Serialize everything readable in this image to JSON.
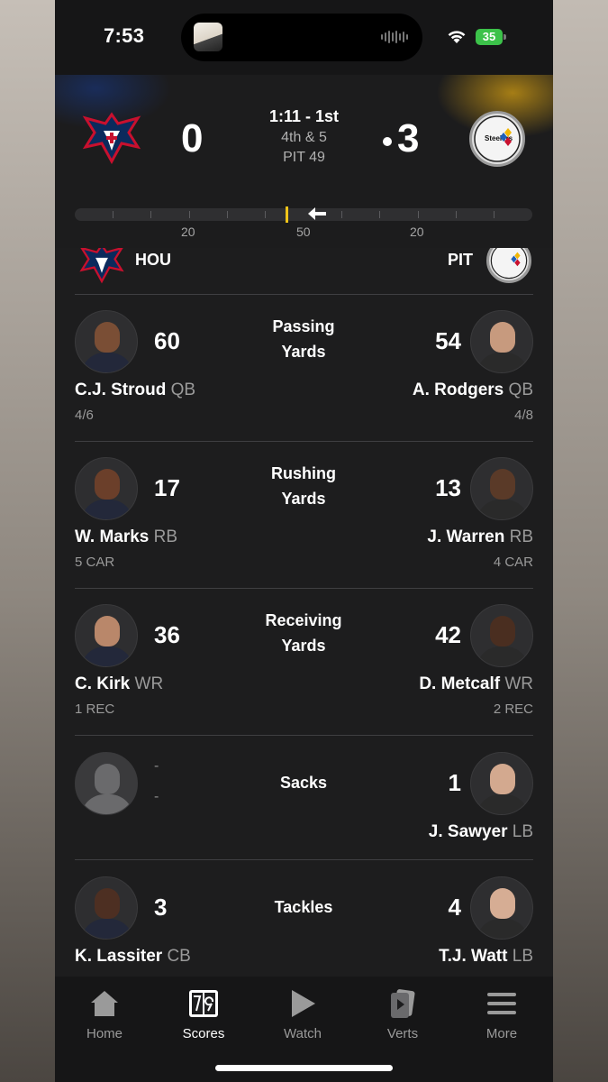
{
  "status_bar": {
    "time": "7:53",
    "battery": "35"
  },
  "game": {
    "clock": "1:11 - 1st",
    "down_distance": "4th & 5",
    "ball_spot": "PIT 49",
    "away": {
      "abbr": "HOU",
      "score": "0",
      "logo_icon": "houston-texans-logo"
    },
    "home": {
      "abbr": "PIT",
      "score": "3",
      "logo_icon": "pittsburgh-steelers-logo",
      "logo_text": "Steelers"
    },
    "field_labels": [
      "20",
      "50",
      "20"
    ],
    "possession": "PIT"
  },
  "stats": [
    {
      "label_line1": "Passing",
      "label_line2": "Yards",
      "left": {
        "value": "60",
        "name": "C.J. Stroud",
        "pos": "QB",
        "sub": "4/6"
      },
      "right": {
        "value": "54",
        "name": "A. Rodgers",
        "pos": "QB",
        "sub": "4/8"
      }
    },
    {
      "label_line1": "Rushing",
      "label_line2": "Yards",
      "left": {
        "value": "17",
        "name": "W. Marks",
        "pos": "RB",
        "sub": "5 CAR"
      },
      "right": {
        "value": "13",
        "name": "J. Warren",
        "pos": "RB",
        "sub": "4 CAR"
      }
    },
    {
      "label_line1": "Receiving",
      "label_line2": "Yards",
      "left": {
        "value": "36",
        "name": "C. Kirk",
        "pos": "WR",
        "sub": "1 REC"
      },
      "right": {
        "value": "42",
        "name": "D. Metcalf",
        "pos": "WR",
        "sub": "2 REC"
      }
    },
    {
      "label_line1": "Sacks",
      "left": {
        "value": "-",
        "sub": "-"
      },
      "right": {
        "value": "1",
        "name": "J. Sawyer",
        "pos": "LB"
      }
    },
    {
      "label_line1": "Tackles",
      "left": {
        "value": "3",
        "name": "K. Lassiter",
        "pos": "CB"
      },
      "right": {
        "value": "4",
        "name": "T.J. Watt",
        "pos": "LB"
      }
    }
  ],
  "tabs": [
    {
      "label": "Home",
      "icon": "home-icon"
    },
    {
      "label": "Scores",
      "icon": "scoreboard-icon",
      "active": true
    },
    {
      "label": "Watch",
      "icon": "play-icon"
    },
    {
      "label": "Verts",
      "icon": "verts-icon"
    },
    {
      "label": "More",
      "icon": "hamburger-menu-icon"
    }
  ]
}
